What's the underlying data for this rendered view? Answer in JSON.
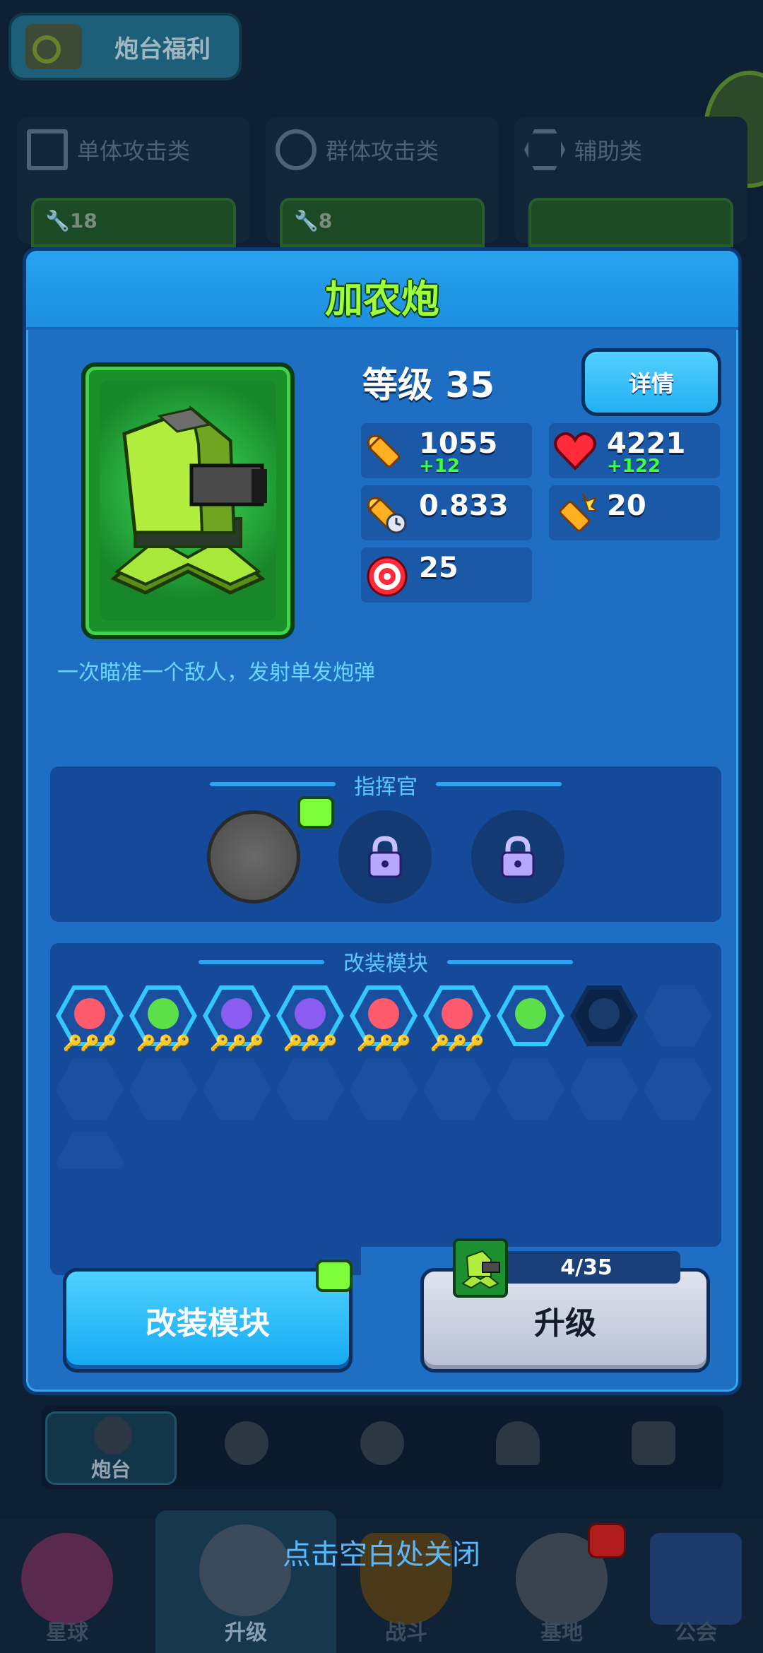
{
  "top_bar": {
    "welfare_label": "炮台福利"
  },
  "category_tabs": [
    {
      "label": "单体攻击类",
      "icon": "checker-icon",
      "count": "18"
    },
    {
      "label": "群体攻击类",
      "icon": "target-ring-icon",
      "count": "8"
    },
    {
      "label": "辅助类",
      "icon": "hexagon-icon",
      "count": ""
    }
  ],
  "panel": {
    "title": "加农炮",
    "level_label": "等级",
    "level_value": "35",
    "detail_button": "详情",
    "description": "一次瞄准一个敌人，发射单发炮弹",
    "stats": [
      {
        "icon": "bullet-icon",
        "value": "1055",
        "bonus": "+12"
      },
      {
        "icon": "heart-icon",
        "value": "4221",
        "bonus": "+122"
      },
      {
        "icon": "fire-rate-icon",
        "value": "0.833",
        "bonus": ""
      },
      {
        "icon": "burst-bullet-icon",
        "value": "20",
        "bonus": ""
      },
      {
        "icon": "target-icon",
        "value": "25",
        "bonus": ""
      }
    ],
    "commander": {
      "title": "指挥官",
      "slots": [
        "empty-active",
        "locked",
        "locked"
      ]
    },
    "modules": {
      "title": "改装模块",
      "filled": [
        {
          "icon": "rocket-icon",
          "color": "#ff5a6e"
        },
        {
          "icon": "heart-module-icon",
          "color": "#5be04a"
        },
        {
          "icon": "cycle-icon",
          "color": "#8a5cf0"
        },
        {
          "icon": "reload-icon",
          "color": "#8a5cf0"
        },
        {
          "icon": "burst-icon",
          "color": "#ff5a6e"
        },
        {
          "icon": "rocket-icon",
          "color": "#ff5a6e"
        },
        {
          "icon": "heart-module-icon",
          "color": "#5be04a"
        },
        {
          "icon": "cycle-dark-icon",
          "color": "#1a3a6a"
        }
      ],
      "keys": "🔑🔑🔑",
      "empty_count": 11
    },
    "mod_button": "改装模块",
    "upgrade_button": "升级",
    "upgrade_progress": "4/35",
    "upgrade_progress_fraction": 0.114
  },
  "sub_nav": [
    {
      "label": "炮台",
      "icon": "turret-icon",
      "active": true
    },
    {
      "label": "",
      "icon": "star-gear-icon",
      "active": false
    },
    {
      "label": "",
      "icon": "lightning-icon",
      "active": false
    },
    {
      "label": "",
      "icon": "helmet-icon",
      "active": false
    },
    {
      "label": "",
      "icon": "monster-icon",
      "active": false
    }
  ],
  "bottom_nav": [
    {
      "label": "星球",
      "icon": "planet-icon"
    },
    {
      "label": "升级",
      "icon": "wrench-hammer-icon"
    },
    {
      "label": "战斗",
      "icon": "shield-icon"
    },
    {
      "label": "基地",
      "icon": "base-icon"
    },
    {
      "label": "公会",
      "icon": "guild-icon"
    }
  ],
  "close_hint": "点击空白处关闭",
  "colors": {
    "panel_blue": "#1e6fc4",
    "title_green": "#9dff3a",
    "bonus_green": "#3fff3f",
    "desc_cyan": "#6cd6ff"
  }
}
